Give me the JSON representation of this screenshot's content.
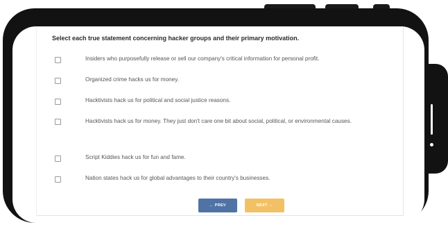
{
  "question": {
    "prompt": "Select each true statement concerning hacker groups and their primary motivation."
  },
  "options": [
    {
      "label": "Insiders who purposefully release or sell our company's critical information for personal profit.",
      "checked": false
    },
    {
      "label": "Organized crime hacks us for money.",
      "checked": false
    },
    {
      "label": "Hacktivists hack us for political and social justice reasons.",
      "checked": false
    },
    {
      "label": "Hacktivists hack us for money. They just don't care one bit about social, political, or environmental causes.",
      "checked": false
    },
    {
      "label": "Script Kiddies hack us for fun and fame.",
      "checked": false
    },
    {
      "label": "Nation states hack us for global advantages to their country's businesses.",
      "checked": false
    }
  ],
  "navigation": {
    "prev_label": "← PREV",
    "next_label": "NEXT →"
  },
  "colors": {
    "prev_button": "#4f73a5",
    "next_button": "#f3c165",
    "device_frame": "#121212"
  }
}
